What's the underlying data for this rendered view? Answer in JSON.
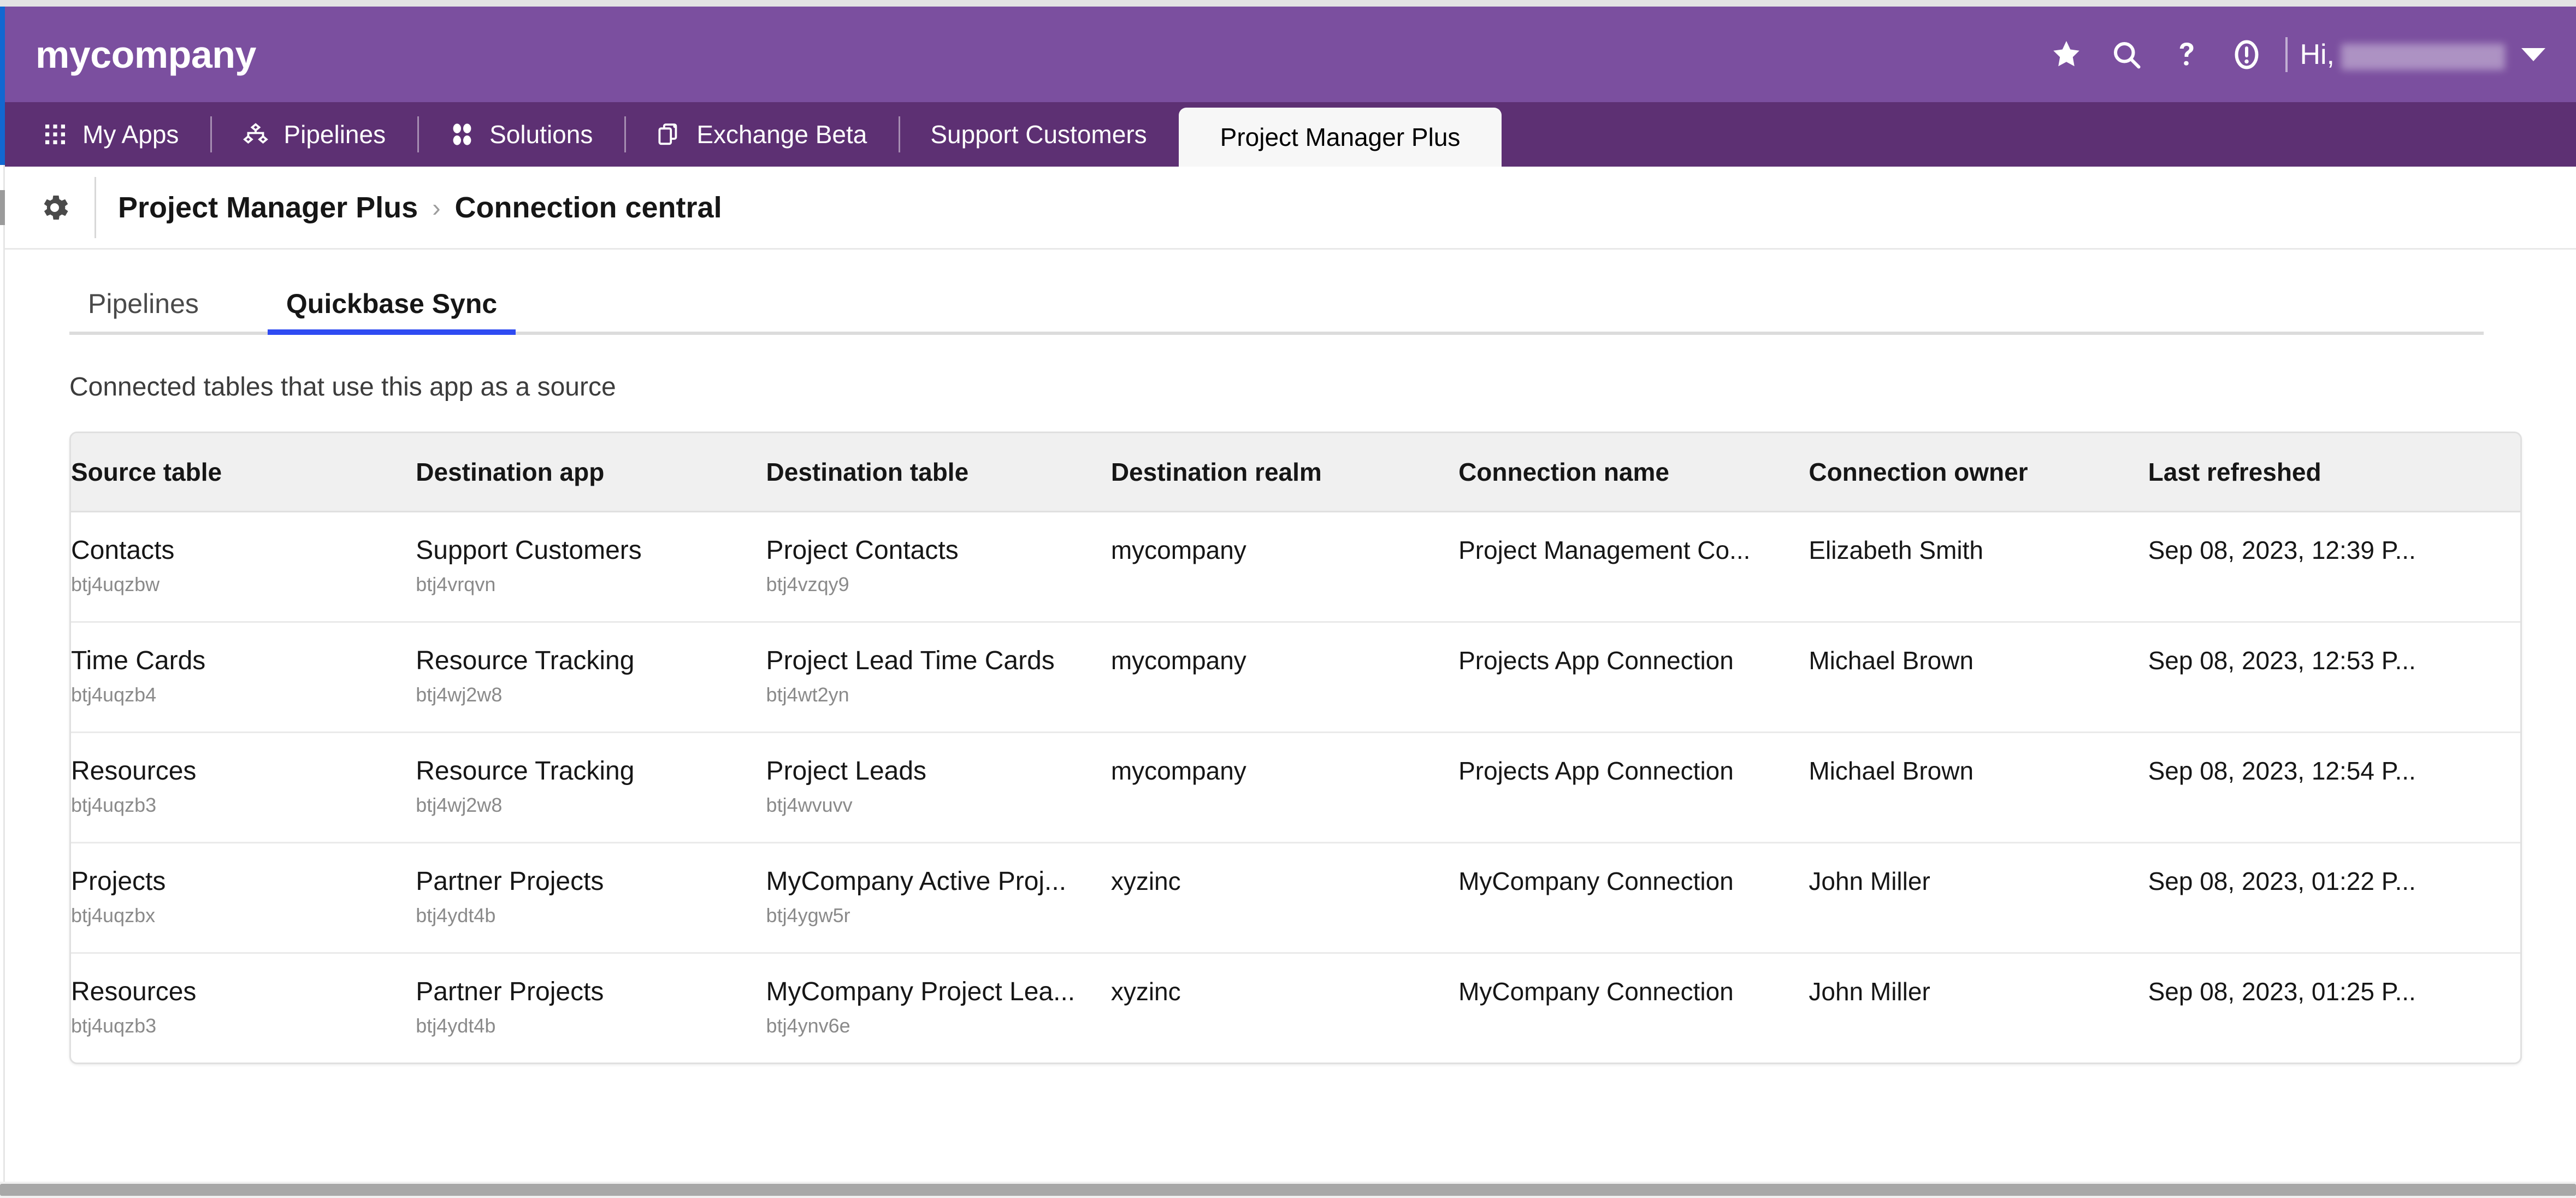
{
  "header": {
    "brand": "mycompany",
    "greeting": "Hi,",
    "icons": [
      {
        "name": "star-icon",
        "label": "Favorites"
      },
      {
        "name": "search-icon",
        "label": "Search"
      },
      {
        "name": "help-icon",
        "label": "Help"
      },
      {
        "name": "alert-icon",
        "label": "Alerts"
      }
    ]
  },
  "app_nav": {
    "items": [
      {
        "label": "My Apps",
        "icon": "grid-icon",
        "active": false
      },
      {
        "label": "Pipelines",
        "icon": "pipelines-icon",
        "active": false
      },
      {
        "label": "Solutions",
        "icon": "solutions-icon",
        "active": false
      },
      {
        "label": "Exchange Beta",
        "icon": "exchange-icon",
        "active": false
      },
      {
        "label": "Support Customers",
        "icon": "",
        "active": false
      },
      {
        "label": "Project Manager Plus",
        "icon": "",
        "active": true
      }
    ]
  },
  "breadcrumb": {
    "gear_icon": "gear-icon",
    "parent": "Project Manager Plus",
    "separator": "›",
    "current": "Connection central"
  },
  "main": {
    "tabs": [
      {
        "label": "Pipelines",
        "active": false
      },
      {
        "label": "Quickbase Sync",
        "active": true
      }
    ],
    "note": "Connected tables that use this app as a source",
    "table": {
      "columns": [
        "Source table",
        "Destination app",
        "Destination table",
        "Destination realm",
        "Connection name",
        "Connection owner",
        "Last refreshed"
      ],
      "rows": [
        {
          "source_table": "Contacts",
          "source_table_id": "btj4uqzbw",
          "destination_app": "Support Customers",
          "destination_app_id": "btj4vrqvn",
          "destination_table": "Project Contacts",
          "destination_table_id": "btj4vzqy9",
          "destination_realm": "mycompany",
          "connection_name": "Project Management Co...",
          "connection_owner": "Elizabeth Smith",
          "last_refreshed": "Sep 08, 2023, 12:39 P..."
        },
        {
          "source_table": "Time Cards",
          "source_table_id": "btj4uqzb4",
          "destination_app": "Resource Tracking",
          "destination_app_id": "btj4wj2w8",
          "destination_table": "Project Lead Time Cards",
          "destination_table_id": "btj4wt2yn",
          "destination_realm": "mycompany",
          "connection_name": "Projects App Connection",
          "connection_owner": "Michael Brown",
          "last_refreshed": "Sep 08, 2023, 12:53 P..."
        },
        {
          "source_table": "Resources",
          "source_table_id": "btj4uqzb3",
          "destination_app": "Resource Tracking",
          "destination_app_id": "btj4wj2w8",
          "destination_table": "Project Leads",
          "destination_table_id": "btj4wvuvv",
          "destination_realm": "mycompany",
          "connection_name": "Projects App Connection",
          "connection_owner": "Michael Brown",
          "last_refreshed": "Sep 08, 2023, 12:54 P..."
        },
        {
          "source_table": "Projects",
          "source_table_id": "btj4uqzbx",
          "destination_app": "Partner Projects",
          "destination_app_id": "btj4ydt4b",
          "destination_table": "MyCompany Active Proj...",
          "destination_table_id": "btj4ygw5r",
          "destination_realm": "xyzinc",
          "connection_name": "MyCompany Connection",
          "connection_owner": "John Miller",
          "last_refreshed": "Sep 08, 2023, 01:22 P..."
        },
        {
          "source_table": "Resources",
          "source_table_id": "btj4uqzb3",
          "destination_app": "Partner Projects",
          "destination_app_id": "btj4ydt4b",
          "destination_table": "MyCompany Project Lea...",
          "destination_table_id": "btj4ynv6e",
          "destination_realm": "xyzinc",
          "connection_name": "MyCompany Connection",
          "connection_owner": "John Miller",
          "last_refreshed": "Sep 08, 2023, 01:25 P..."
        }
      ]
    }
  },
  "colors": {
    "header_purple": "#7b4f9f",
    "nav_purple": "#5d3073",
    "tab_accent_blue": "#2f4bf2",
    "table_header_bg": "#f0f0f0",
    "muted_text": "#8a8a8a"
  }
}
